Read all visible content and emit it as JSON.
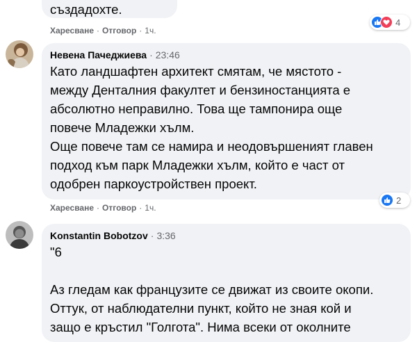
{
  "comment1": {
    "text_tail": "създадохте.",
    "actions": {
      "like": "Харесване",
      "reply": "Отговор",
      "time": "1ч."
    },
    "reactions": {
      "icons": [
        "like-icon",
        "heart-icon"
      ],
      "count": "4"
    }
  },
  "comment2": {
    "author": "Невена Пачеджиева",
    "time": "23:46",
    "text": "Като ландшафтен архитект смятам, че мястото -\nмежду Денталния факултет и бензиностанцията е\nабсолютно неправилно. Това ще тампонира още\nповече Младежки хълм.\nОще повече там се намира и неодовършеният главен\nподход към парк Младежки хълм, който е част от\nодобрен паркоустройствен проект.",
    "actions": {
      "like": "Харесване",
      "reply": "Отговор",
      "time": "1ч."
    },
    "reactions": {
      "icons": [
        "like-icon"
      ],
      "count": "2"
    }
  },
  "comment3": {
    "author": "Konstantin Bobotzov",
    "time": "3:36",
    "text": "\"6\n\nАз гледам как французите се движат из своите окопи.\nОттук, от наблюдателни пункт, който не зная кой и\nзащо е кръстил \"Голгота\". Нима всеки от околните"
  },
  "colors": {
    "bubble_bg": "#f0f2f5",
    "secondary_text": "#65676b",
    "like_blue": "#1877f2",
    "love_red": "#f33e58"
  }
}
